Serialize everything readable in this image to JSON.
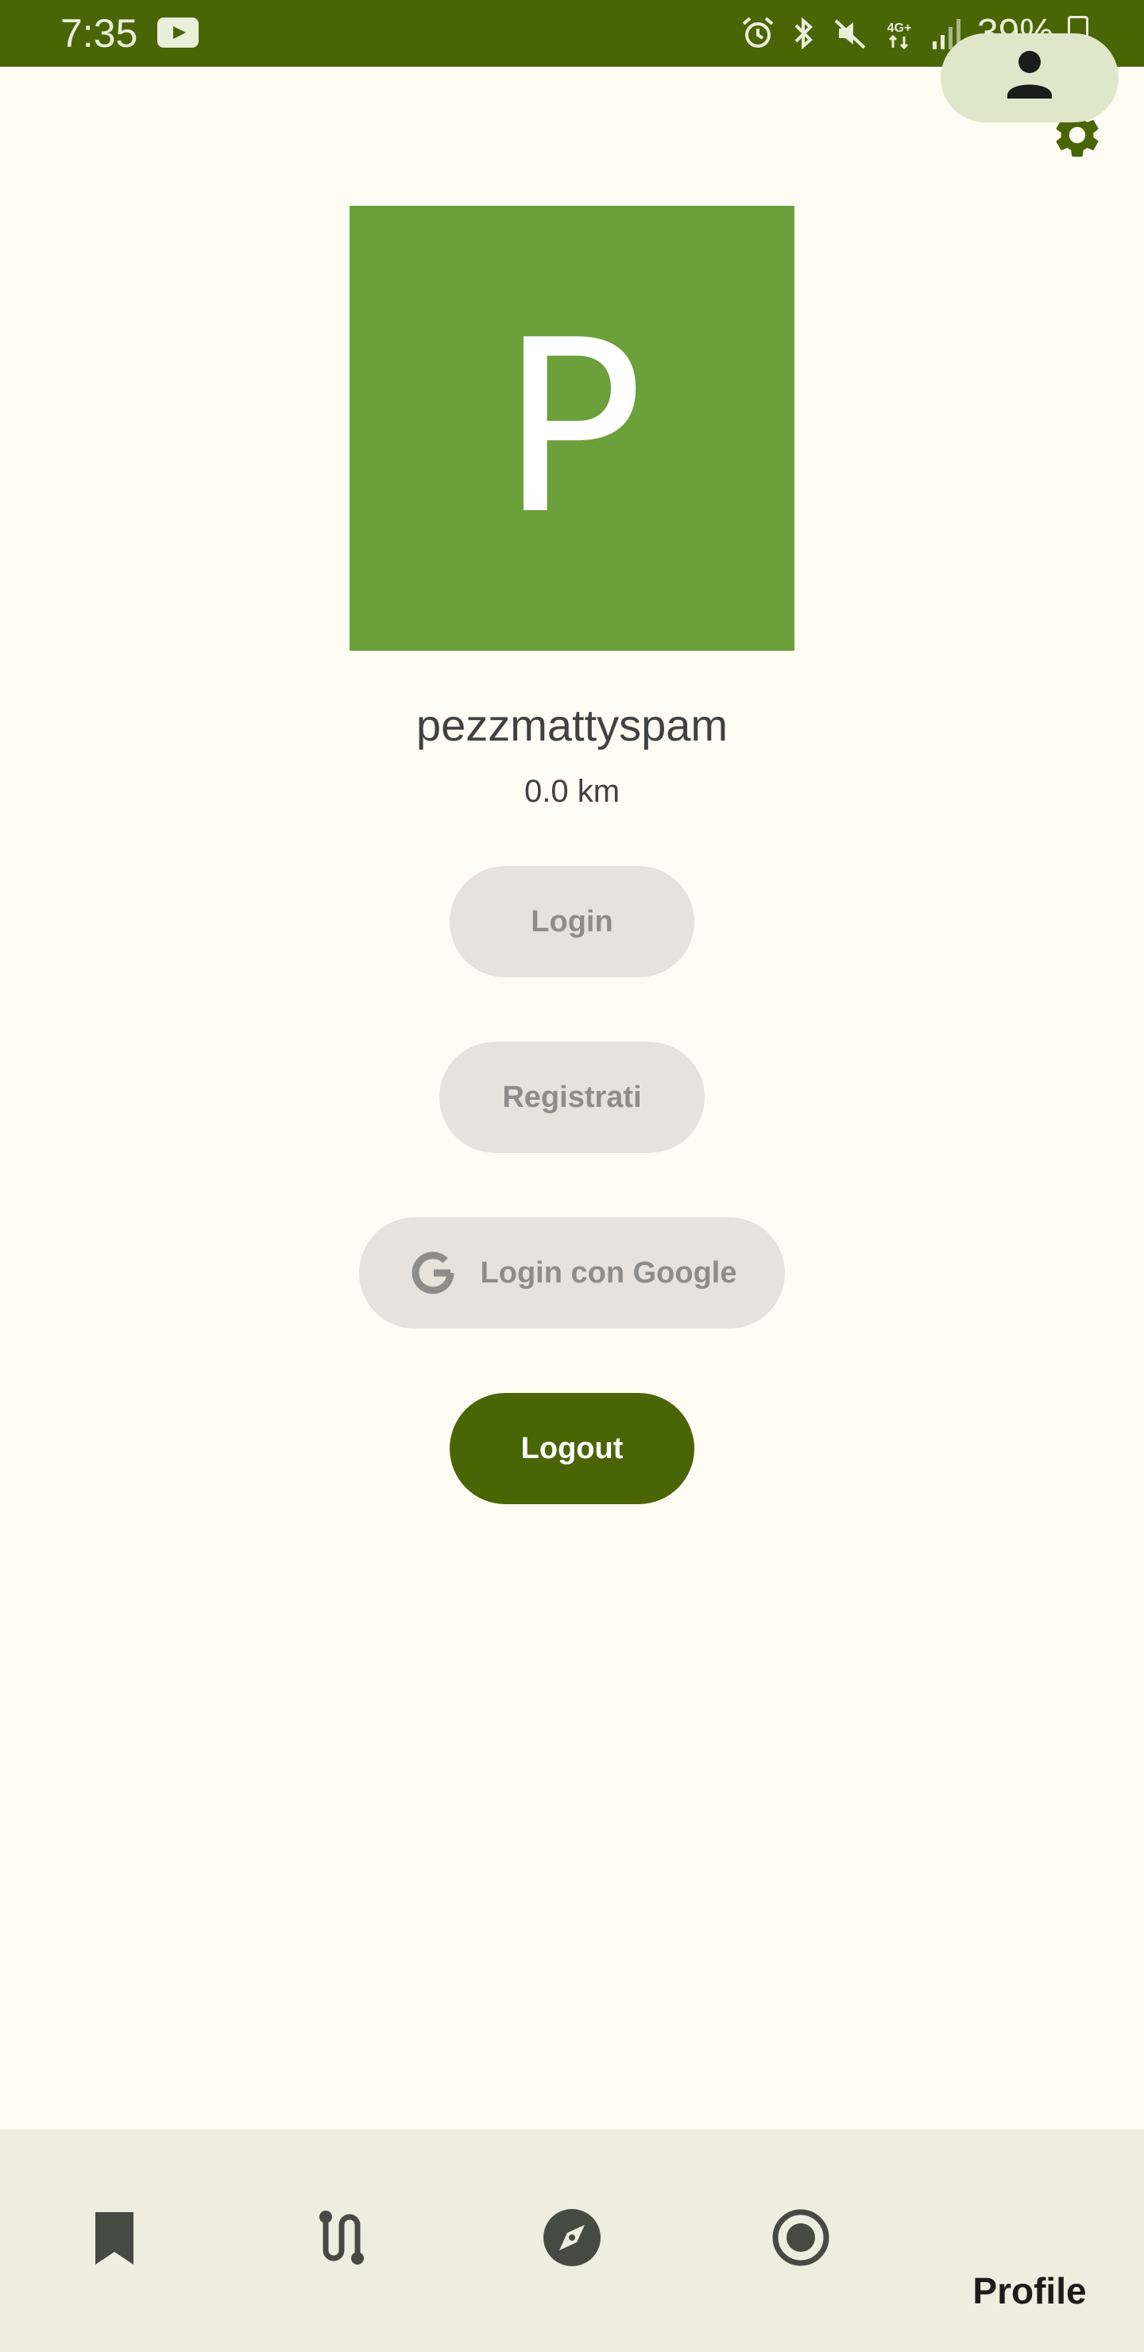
{
  "status_bar": {
    "time": "7:35",
    "battery": "39%",
    "network": "4G+"
  },
  "profile": {
    "avatar_letter": "P",
    "avatar_color": "#6ba03a",
    "username": "pezzmattyspam",
    "distance": "0.0 km"
  },
  "buttons": {
    "login": "Login",
    "register": "Registrati",
    "google_login": "Login con Google",
    "logout": "Logout"
  },
  "bottom_nav": {
    "items": [
      {
        "icon": "bookmark-icon"
      },
      {
        "icon": "route-icon"
      },
      {
        "icon": "compass-icon"
      },
      {
        "icon": "record-icon"
      },
      {
        "icon": "person-icon",
        "label": "Profile",
        "active": true
      }
    ]
  },
  "colors": {
    "accent": "#4a6506",
    "background": "#fffcf4",
    "nav_background": "#eeeee0"
  }
}
